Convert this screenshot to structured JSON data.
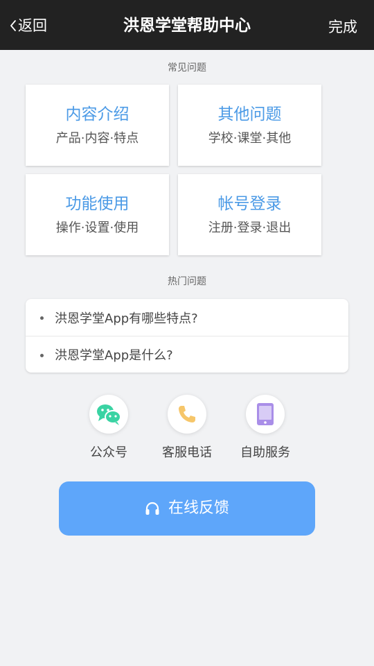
{
  "header": {
    "back_label": "返回",
    "title": "洪恩学堂帮助中心",
    "done_label": "完成",
    "background": "#222222"
  },
  "faq": {
    "section_label": "常见问题",
    "categories": [
      {
        "title": "内容介绍",
        "subtitle": "产品·内容·特点"
      },
      {
        "title": "其他问题",
        "subtitle": "学校·课堂·其他"
      },
      {
        "title": "功能使用",
        "subtitle": "操作·设置·使用"
      },
      {
        "title": "帐号登录",
        "subtitle": "注册·登录·退出"
      }
    ],
    "title_color": "#4b9ae6"
  },
  "hot": {
    "section_label": "热门问题",
    "items": [
      {
        "text": "洪恩学堂App有哪些特点?"
      },
      {
        "text": "洪恩学堂App是什么?"
      }
    ]
  },
  "contacts": [
    {
      "label": "公众号",
      "icon": "wechat-icon",
      "color": "#3ad3a3"
    },
    {
      "label": "客服电话",
      "icon": "phone-icon",
      "color": "#f6c66a"
    },
    {
      "label": "自助服务",
      "icon": "tablet-icon",
      "color": "#a98ee8"
    }
  ],
  "feedback": {
    "label": "在线反馈",
    "icon": "headset-icon",
    "color": "#5ea6fa"
  }
}
